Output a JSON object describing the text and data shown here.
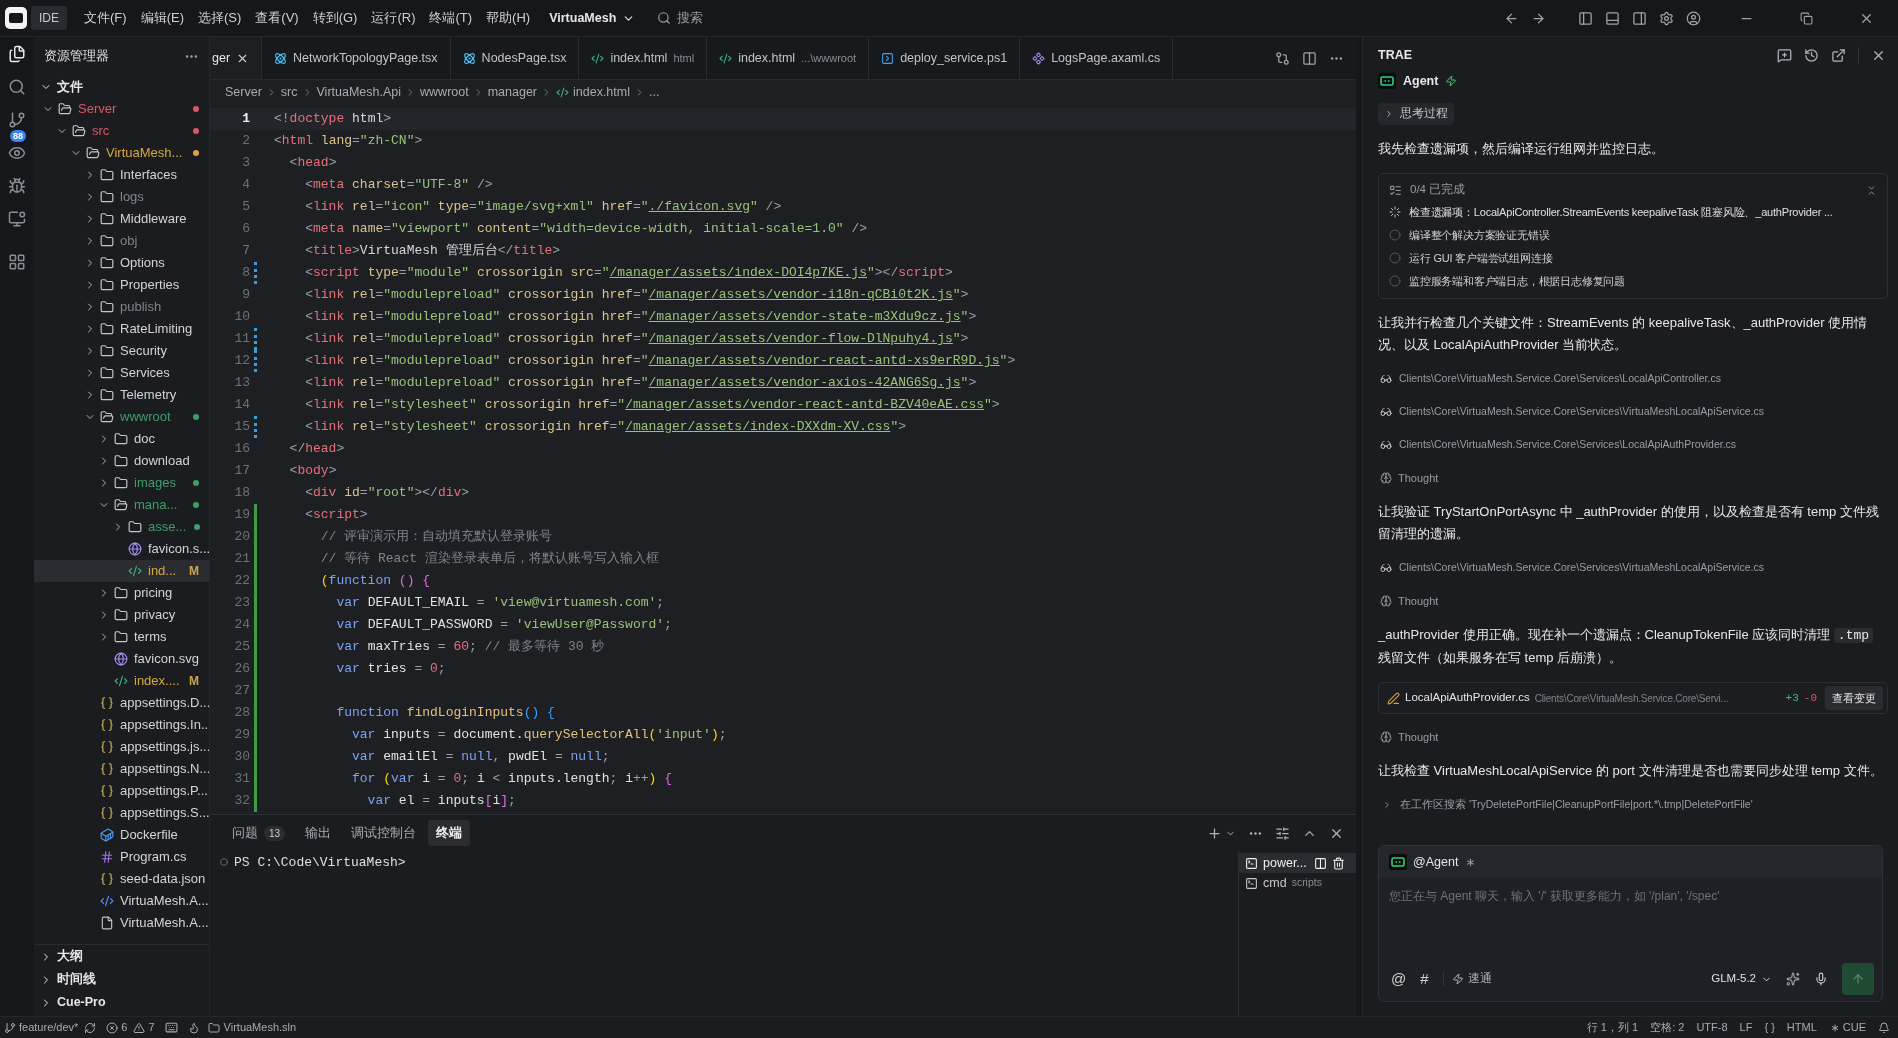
{
  "titlebar": {
    "badge": "IDE",
    "menus": [
      "文件(F)",
      "编辑(E)",
      "选择(S)",
      "查看(V)",
      "转到(G)",
      "运行(R)",
      "终端(T)",
      "帮助(H)"
    ],
    "project": "VirtuaMesh",
    "search_label": "搜索"
  },
  "activity_bar": [
    {
      "kind": "files",
      "selected": true
    },
    {
      "kind": "search",
      "selected": false
    },
    {
      "kind": "scm",
      "selected": false,
      "badge": "88"
    },
    {
      "kind": "preview",
      "selected": false
    },
    {
      "kind": "debug",
      "selected": false
    },
    {
      "kind": "remote",
      "selected": false
    },
    {
      "kind": "extensions",
      "selected": false
    }
  ],
  "explorer": {
    "title": "资源管理器",
    "section": {
      "label": "文件",
      "expanded": true
    },
    "tree": [
      {
        "name": "Server",
        "kind": "folder",
        "expanded": true,
        "selected": false,
        "color": "#e05561",
        "dot": true,
        "children": [
          {
            "name": "src",
            "kind": "folder",
            "expanded": true,
            "selected": false,
            "color": "#e05561",
            "dot": true,
            "children": [
              {
                "name": "VirtuaMesh...",
                "kind": "folder",
                "expanded": true,
                "selected": false,
                "color": "#d7a93a",
                "dot": true,
                "children": [
                  {
                    "name": "Interfaces",
                    "kind": "folder",
                    "expanded": false,
                    "selected": false
                  },
                  {
                    "name": "logs",
                    "kind": "folder",
                    "expanded": false,
                    "selected": false,
                    "color": "#80838b"
                  },
                  {
                    "name": "Middleware",
                    "kind": "folder",
                    "expanded": false,
                    "selected": false
                  },
                  {
                    "name": "obj",
                    "kind": "folder",
                    "expanded": false,
                    "selected": false,
                    "color": "#80838b"
                  },
                  {
                    "name": "Options",
                    "kind": "folder",
                    "expanded": false,
                    "selected": false
                  },
                  {
                    "name": "Properties",
                    "kind": "folder",
                    "expanded": false,
                    "selected": false
                  },
                  {
                    "name": "publish",
                    "kind": "folder",
                    "expanded": false,
                    "selected": false,
                    "color": "#80838b"
                  },
                  {
                    "name": "RateLimiting",
                    "kind": "folder",
                    "expanded": false,
                    "selected": false
                  },
                  {
                    "name": "Security",
                    "kind": "folder",
                    "expanded": false,
                    "selected": false
                  },
                  {
                    "name": "Services",
                    "kind": "folder",
                    "expanded": false,
                    "selected": false
                  },
                  {
                    "name": "Telemetry",
                    "kind": "folder",
                    "expanded": false,
                    "selected": false
                  },
                  {
                    "name": "wwwroot",
                    "kind": "folder",
                    "expanded": true,
                    "selected": false,
                    "color": "#3e9e6a",
                    "dot": true,
                    "children": [
                      {
                        "name": "doc",
                        "kind": "folder",
                        "expanded": false,
                        "selected": false
                      },
                      {
                        "name": "download",
                        "kind": "folder",
                        "expanded": false,
                        "selected": false
                      },
                      {
                        "name": "images",
                        "kind": "folder",
                        "expanded": false,
                        "selected": false,
                        "color": "#3e9e6a",
                        "dot": true
                      },
                      {
                        "name": "mana...",
                        "kind": "folder",
                        "expanded": true,
                        "selected": false,
                        "color": "#3e9e6a",
                        "dot": true,
                        "children": [
                          {
                            "name": "asse...",
                            "kind": "folder",
                            "expanded": false,
                            "selected": false,
                            "color": "#3e9e6a",
                            "dot": true
                          },
                          {
                            "name": "favicon.s...",
                            "kind": "svg",
                            "selected": false
                          },
                          {
                            "name": "ind...",
                            "kind": "html",
                            "selected": true,
                            "color": "#d7a93a",
                            "badge": "M"
                          }
                        ]
                      },
                      {
                        "name": "pricing",
                        "kind": "folder",
                        "expanded": false,
                        "selected": false
                      },
                      {
                        "name": "privacy",
                        "kind": "folder",
                        "expanded": false,
                        "selected": false
                      },
                      {
                        "name": "terms",
                        "kind": "folder",
                        "expanded": false,
                        "selected": false
                      },
                      {
                        "name": "favicon.svg",
                        "kind": "svg",
                        "selected": false
                      },
                      {
                        "name": "index....",
                        "kind": "html",
                        "selected": false,
                        "color": "#d7a93a",
                        "badge": "M"
                      }
                    ]
                  },
                  {
                    "name": "appsettings.D...",
                    "kind": "json",
                    "selected": false
                  },
                  {
                    "name": "appsettings.In...",
                    "kind": "json",
                    "selected": false
                  },
                  {
                    "name": "appsettings.js...",
                    "kind": "json",
                    "selected": false
                  },
                  {
                    "name": "appsettings.N...",
                    "kind": "json",
                    "selected": false
                  },
                  {
                    "name": "appsettings.P...",
                    "kind": "json",
                    "selected": false
                  },
                  {
                    "name": "appsettings.S...",
                    "kind": "json",
                    "selected": false
                  },
                  {
                    "name": "Dockerfile",
                    "kind": "docker",
                    "selected": false
                  },
                  {
                    "name": "Program.cs",
                    "kind": "csharp",
                    "selected": false
                  },
                  {
                    "name": "seed-data.json",
                    "kind": "json",
                    "selected": false
                  },
                  {
                    "name": "VirtuaMesh.A...",
                    "kind": "xml",
                    "selected": false
                  },
                  {
                    "name": "VirtuaMesh.A...",
                    "kind": "plain",
                    "selected": false
                  }
                ]
              }
            ]
          }
        ]
      }
    ],
    "footer_sections": [
      {
        "label": "大纲",
        "expanded": false
      },
      {
        "label": "时间线",
        "expanded": false
      },
      {
        "label": "Cue-Pro",
        "expanded": false
      }
    ]
  },
  "editor": {
    "tabs": [
      {
        "label": "ger",
        "kind": "cut",
        "selected": true
      },
      {
        "label": "NetworkTopologyPage.tsx",
        "kind": "react",
        "selected": false
      },
      {
        "label": "NodesPage.tsx",
        "kind": "react",
        "selected": false
      },
      {
        "label": "index.html",
        "detail": "html",
        "kind": "html",
        "selected": false
      },
      {
        "label": "index.html",
        "detail": "...\\wwwroot",
        "kind": "html",
        "selected": false
      },
      {
        "label": "deploy_service.ps1",
        "kind": "powershell",
        "selected": false
      },
      {
        "label": "LogsPage.axaml.cs",
        "kind": "axaml",
        "selected": false
      }
    ],
    "breadcrumb": [
      {
        "label": "Server",
        "kind": "folder"
      },
      {
        "label": "src",
        "kind": "folder"
      },
      {
        "label": "VirtuaMesh.Api",
        "kind": "folder"
      },
      {
        "label": "wwwroot",
        "kind": "folder"
      },
      {
        "label": "manager",
        "kind": "folder"
      },
      {
        "label": "index.html",
        "kind": "html"
      },
      {
        "label": "...",
        "kind": "symbol"
      }
    ],
    "lines": [
      {
        "n": "1",
        "current": true,
        "kind": "plain",
        "tokens": [
          {
            "kind": "p",
            "text": "<!"
          },
          {
            "kind": "tag",
            "text": "doctype "
          },
          {
            "kind": "txt",
            "text": "html"
          },
          {
            "kind": "p",
            "text": ">"
          }
        ]
      },
      {
        "n": "2",
        "current": false,
        "kind": "plain",
        "tokens": [
          {
            "kind": "p",
            "text": "<"
          },
          {
            "kind": "tag",
            "text": "html "
          },
          {
            "kind": "attr",
            "text": "lang"
          },
          {
            "kind": "p",
            "text": "="
          },
          {
            "kind": "str",
            "text": "\"zh-CN\""
          },
          {
            "kind": "p",
            "text": ">"
          }
        ]
      },
      {
        "n": "3",
        "current": false,
        "kind": "plain",
        "tokens": [
          {
            "kind": "p",
            "text": "  <"
          },
          {
            "kind": "tag",
            "text": "head"
          },
          {
            "kind": "p",
            "text": ">"
          }
        ]
      },
      {
        "n": "4",
        "current": false,
        "kind": "plain",
        "tokens": [
          {
            "kind": "p",
            "text": "    <"
          },
          {
            "kind": "tag",
            "text": "meta "
          },
          {
            "kind": "attr",
            "text": "charset"
          },
          {
            "kind": "p",
            "text": "="
          },
          {
            "kind": "str",
            "text": "\"UTF-8\" "
          },
          {
            "kind": "p",
            "text": "/>"
          }
        ]
      },
      {
        "n": "5",
        "current": false,
        "kind": "plain",
        "tokens": [
          {
            "kind": "p",
            "text": "    <"
          },
          {
            "kind": "tag",
            "text": "link "
          },
          {
            "kind": "attr",
            "text": "rel"
          },
          {
            "kind": "p",
            "text": "="
          },
          {
            "kind": "str",
            "text": "\"icon\" "
          },
          {
            "kind": "attr",
            "text": "type"
          },
          {
            "kind": "p",
            "text": "="
          },
          {
            "kind": "str",
            "text": "\"image/svg+xml\" "
          },
          {
            "kind": "attr",
            "text": "href"
          },
          {
            "kind": "p",
            "text": "="
          },
          {
            "kind": "str",
            "text": "\""
          },
          {
            "kind": "link",
            "text": "./favicon.svg"
          },
          {
            "kind": "str",
            "text": "\" "
          },
          {
            "kind": "p",
            "text": "/>"
          }
        ]
      },
      {
        "n": "6",
        "current": false,
        "kind": "plain",
        "tokens": [
          {
            "kind": "p",
            "text": "    <"
          },
          {
            "kind": "tag",
            "text": "meta "
          },
          {
            "kind": "attr",
            "text": "name"
          },
          {
            "kind": "p",
            "text": "="
          },
          {
            "kind": "str",
            "text": "\"viewport\" "
          },
          {
            "kind": "attr",
            "text": "content"
          },
          {
            "kind": "p",
            "text": "="
          },
          {
            "kind": "str",
            "text": "\"width=device-width, initial-scale=1.0\" "
          },
          {
            "kind": "p",
            "text": "/>"
          }
        ]
      },
      {
        "n": "7",
        "current": false,
        "kind": "plain",
        "tokens": [
          {
            "kind": "p",
            "text": "    <"
          },
          {
            "kind": "tag",
            "text": "title"
          },
          {
            "kind": "p",
            "text": ">"
          },
          {
            "kind": "txt",
            "text": "VirtuaMesh 管理后台"
          },
          {
            "kind": "p",
            "text": "</"
          },
          {
            "kind": "tag",
            "text": "title"
          },
          {
            "kind": "p",
            "text": ">"
          }
        ]
      },
      {
        "n": "8",
        "current": false,
        "kind": "modified",
        "tokens": [
          {
            "kind": "p",
            "text": "    <"
          },
          {
            "kind": "tag",
            "text": "script "
          },
          {
            "kind": "attr",
            "text": "type"
          },
          {
            "kind": "p",
            "text": "="
          },
          {
            "kind": "str",
            "text": "\"module\" "
          },
          {
            "kind": "attr",
            "text": "crossorigin src"
          },
          {
            "kind": "p",
            "text": "="
          },
          {
            "kind": "str",
            "text": "\""
          },
          {
            "kind": "link",
            "text": "/manager/assets/index-DOI4p7KE.js"
          },
          {
            "kind": "str",
            "text": "\""
          },
          {
            "kind": "p",
            "text": "></"
          },
          {
            "kind": "tag",
            "text": "script"
          },
          {
            "kind": "p",
            "text": ">"
          }
        ]
      },
      {
        "n": "9",
        "current": false,
        "kind": "plain",
        "tokens": [
          {
            "kind": "p",
            "text": "    <"
          },
          {
            "kind": "tag",
            "text": "link "
          },
          {
            "kind": "attr",
            "text": "rel"
          },
          {
            "kind": "p",
            "text": "="
          },
          {
            "kind": "str",
            "text": "\"modulepreload\" "
          },
          {
            "kind": "attr",
            "text": "crossorigin href"
          },
          {
            "kind": "p",
            "text": "="
          },
          {
            "kind": "str",
            "text": "\""
          },
          {
            "kind": "link",
            "text": "/manager/assets/vendor-i18n-qCBi0t2K.js"
          },
          {
            "kind": "str",
            "text": "\""
          },
          {
            "kind": "p",
            "text": ">"
          }
        ]
      },
      {
        "n": "10",
        "current": false,
        "kind": "plain",
        "tokens": [
          {
            "kind": "p",
            "text": "    <"
          },
          {
            "kind": "tag",
            "text": "link "
          },
          {
            "kind": "attr",
            "text": "rel"
          },
          {
            "kind": "p",
            "text": "="
          },
          {
            "kind": "str",
            "text": "\"modulepreload\" "
          },
          {
            "kind": "attr",
            "text": "crossorigin href"
          },
          {
            "kind": "p",
            "text": "="
          },
          {
            "kind": "str",
            "text": "\""
          },
          {
            "kind": "link",
            "text": "/manager/assets/vendor-state-m3Xdu9cz.js"
          },
          {
            "kind": "str",
            "text": "\""
          },
          {
            "kind": "p",
            "text": ">"
          }
        ]
      },
      {
        "n": "11",
        "current": false,
        "kind": "modified",
        "tokens": [
          {
            "kind": "p",
            "text": "    <"
          },
          {
            "kind": "tag",
            "text": "link "
          },
          {
            "kind": "attr",
            "text": "rel"
          },
          {
            "kind": "p",
            "text": "="
          },
          {
            "kind": "str",
            "text": "\"modulepreload\" "
          },
          {
            "kind": "attr",
            "text": "crossorigin href"
          },
          {
            "kind": "p",
            "text": "="
          },
          {
            "kind": "str",
            "text": "\""
          },
          {
            "kind": "link",
            "text": "/manager/assets/vendor-flow-DlNpuhy4.js"
          },
          {
            "kind": "str",
            "text": "\""
          },
          {
            "kind": "p",
            "text": ">"
          }
        ]
      },
      {
        "n": "12",
        "current": false,
        "kind": "modified",
        "tokens": [
          {
            "kind": "p",
            "text": "    <"
          },
          {
            "kind": "tag",
            "text": "link "
          },
          {
            "kind": "attr",
            "text": "rel"
          },
          {
            "kind": "p",
            "text": "="
          },
          {
            "kind": "str",
            "text": "\"modulepreload\" "
          },
          {
            "kind": "attr",
            "text": "crossorigin href"
          },
          {
            "kind": "p",
            "text": "="
          },
          {
            "kind": "str",
            "text": "\""
          },
          {
            "kind": "link",
            "text": "/manager/assets/vendor-react-antd-xs9erR9D.js"
          },
          {
            "kind": "str",
            "text": "\""
          },
          {
            "kind": "p",
            "text": ">"
          }
        ]
      },
      {
        "n": "13",
        "current": false,
        "kind": "plain",
        "tokens": [
          {
            "kind": "p",
            "text": "    <"
          },
          {
            "kind": "tag",
            "text": "link "
          },
          {
            "kind": "attr",
            "text": "rel"
          },
          {
            "kind": "p",
            "text": "="
          },
          {
            "kind": "str",
            "text": "\"modulepreload\" "
          },
          {
            "kind": "attr",
            "text": "crossorigin href"
          },
          {
            "kind": "p",
            "text": "="
          },
          {
            "kind": "str",
            "text": "\""
          },
          {
            "kind": "link",
            "text": "/manager/assets/vendor-axios-42ANG6Sg.js"
          },
          {
            "kind": "str",
            "text": "\""
          },
          {
            "kind": "p",
            "text": ">"
          }
        ]
      },
      {
        "n": "14",
        "current": false,
        "kind": "plain",
        "tokens": [
          {
            "kind": "p",
            "text": "    <"
          },
          {
            "kind": "tag",
            "text": "link "
          },
          {
            "kind": "attr",
            "text": "rel"
          },
          {
            "kind": "p",
            "text": "="
          },
          {
            "kind": "str",
            "text": "\"stylesheet\" "
          },
          {
            "kind": "attr",
            "text": "crossorigin href"
          },
          {
            "kind": "p",
            "text": "="
          },
          {
            "kind": "str",
            "text": "\""
          },
          {
            "kind": "link",
            "text": "/manager/assets/vendor-react-antd-BZV40eAE.css"
          },
          {
            "kind": "str",
            "text": "\""
          },
          {
            "kind": "p",
            "text": ">"
          }
        ]
      },
      {
        "n": "15",
        "current": false,
        "kind": "modified",
        "tokens": [
          {
            "kind": "p",
            "text": "    <"
          },
          {
            "kind": "tag",
            "text": "link "
          },
          {
            "kind": "attr",
            "text": "rel"
          },
          {
            "kind": "p",
            "text": "="
          },
          {
            "kind": "str",
            "text": "\"stylesheet\" "
          },
          {
            "kind": "attr",
            "text": "crossorigin href"
          },
          {
            "kind": "p",
            "text": "="
          },
          {
            "kind": "str",
            "text": "\""
          },
          {
            "kind": "link",
            "text": "/manager/assets/index-DXXdm-XV.css"
          },
          {
            "kind": "str",
            "text": "\""
          },
          {
            "kind": "p",
            "text": ">"
          }
        ]
      },
      {
        "n": "16",
        "current": false,
        "kind": "plain",
        "tokens": [
          {
            "kind": "p",
            "text": "  </"
          },
          {
            "kind": "tag",
            "text": "head"
          },
          {
            "kind": "p",
            "text": ">"
          }
        ]
      },
      {
        "n": "17",
        "current": false,
        "kind": "plain",
        "tokens": [
          {
            "kind": "p",
            "text": "  <"
          },
          {
            "kind": "tag",
            "text": "body"
          },
          {
            "kind": "p",
            "text": ">"
          }
        ]
      },
      {
        "n": "18",
        "current": false,
        "kind": "plain",
        "tokens": [
          {
            "kind": "p",
            "text": "    <"
          },
          {
            "kind": "tag",
            "text": "div "
          },
          {
            "kind": "attr",
            "text": "id"
          },
          {
            "kind": "p",
            "text": "="
          },
          {
            "kind": "str",
            "text": "\"root\""
          },
          {
            "kind": "p",
            "text": "></"
          },
          {
            "kind": "tag",
            "text": "div"
          },
          {
            "kind": "p",
            "text": ">"
          }
        ]
      },
      {
        "n": "19",
        "current": false,
        "kind": "added",
        "tokens": [
          {
            "kind": "p",
            "text": "    <"
          },
          {
            "kind": "tag",
            "text": "script"
          },
          {
            "kind": "p",
            "text": ">"
          }
        ]
      },
      {
        "n": "20",
        "current": false,
        "kind": "added",
        "tokens": [
          {
            "kind": "cm",
            "text": "      // 评审演示用：自动填充默认登录账号"
          }
        ]
      },
      {
        "n": "21",
        "current": false,
        "kind": "added",
        "tokens": [
          {
            "kind": "cm",
            "text": "      // 等待 React 渲染登录表单后，将默认账号写入输入框"
          }
        ]
      },
      {
        "n": "22",
        "current": false,
        "kind": "added",
        "tokens": [
          {
            "kind": "b1",
            "text": "      ("
          },
          {
            "kind": "kw",
            "text": "function "
          },
          {
            "kind": "b2",
            "text": "() {"
          }
        ]
      },
      {
        "n": "23",
        "current": false,
        "kind": "added",
        "tokens": [
          {
            "kind": "kw",
            "text": "        var "
          },
          {
            "kind": "id",
            "text": "DEFAULT_EMAIL "
          },
          {
            "kind": "p",
            "text": "= "
          },
          {
            "kind": "str",
            "text": "'view@virtuamesh.com'"
          },
          {
            "kind": "p",
            "text": ";"
          }
        ]
      },
      {
        "n": "24",
        "current": false,
        "kind": "added",
        "tokens": [
          {
            "kind": "kw",
            "text": "        var "
          },
          {
            "kind": "id",
            "text": "DEFAULT_PASSWORD "
          },
          {
            "kind": "p",
            "text": "= "
          },
          {
            "kind": "str",
            "text": "'viewUser@Password'"
          },
          {
            "kind": "p",
            "text": ";"
          }
        ]
      },
      {
        "n": "25",
        "current": false,
        "kind": "added",
        "tokens": [
          {
            "kind": "kw",
            "text": "        var "
          },
          {
            "kind": "id",
            "text": "maxTries "
          },
          {
            "kind": "p",
            "text": "= "
          },
          {
            "kind": "num",
            "text": "60"
          },
          {
            "kind": "p",
            "text": "; "
          },
          {
            "kind": "cm",
            "text": "// 最多等待 30 秒"
          }
        ]
      },
      {
        "n": "26",
        "current": false,
        "kind": "added",
        "tokens": [
          {
            "kind": "kw",
            "text": "        var "
          },
          {
            "kind": "id",
            "text": "tries "
          },
          {
            "kind": "p",
            "text": "= "
          },
          {
            "kind": "num",
            "text": "0"
          },
          {
            "kind": "p",
            "text": ";"
          }
        ]
      },
      {
        "n": "27",
        "current": false,
        "kind": "added"
      },
      {
        "n": "28",
        "current": false,
        "kind": "added",
        "tokens": [
          {
            "kind": "kw",
            "text": "        function "
          },
          {
            "kind": "fn",
            "text": "findLoginInputs"
          },
          {
            "kind": "b3",
            "text": "() {"
          }
        ]
      },
      {
        "n": "29",
        "current": false,
        "kind": "added",
        "tokens": [
          {
            "kind": "kw",
            "text": "          var "
          },
          {
            "kind": "id",
            "text": "inputs "
          },
          {
            "kind": "p",
            "text": "= "
          },
          {
            "kind": "id",
            "text": "document."
          },
          {
            "kind": "fn",
            "text": "querySelectorAll"
          },
          {
            "kind": "b1",
            "text": "("
          },
          {
            "kind": "str",
            "text": "'input'"
          },
          {
            "kind": "b1",
            "text": ")"
          },
          {
            "kind": "p",
            "text": ";"
          }
        ]
      },
      {
        "n": "30",
        "current": false,
        "kind": "added",
        "tokens": [
          {
            "kind": "kw",
            "text": "          var "
          },
          {
            "kind": "id",
            "text": "emailEl "
          },
          {
            "kind": "p",
            "text": "= "
          },
          {
            "kind": "kw",
            "text": "null"
          },
          {
            "kind": "p",
            "text": ", "
          },
          {
            "kind": "id",
            "text": "pwdEl "
          },
          {
            "kind": "p",
            "text": "= "
          },
          {
            "kind": "kw",
            "text": "null"
          },
          {
            "kind": "p",
            "text": ";"
          }
        ]
      },
      {
        "n": "31",
        "current": false,
        "kind": "added",
        "tokens": [
          {
            "kind": "kw",
            "text": "          for "
          },
          {
            "kind": "b1",
            "text": "("
          },
          {
            "kind": "kw",
            "text": "var "
          },
          {
            "kind": "id",
            "text": "i "
          },
          {
            "kind": "p",
            "text": "= "
          },
          {
            "kind": "num",
            "text": "0"
          },
          {
            "kind": "p",
            "text": "; "
          },
          {
            "kind": "id",
            "text": "i "
          },
          {
            "kind": "p",
            "text": "< "
          },
          {
            "kind": "id",
            "text": "inputs.length"
          },
          {
            "kind": "p",
            "text": "; "
          },
          {
            "kind": "id",
            "text": "i"
          },
          {
            "kind": "p",
            "text": "++"
          },
          {
            "kind": "b1",
            "text": ") "
          },
          {
            "kind": "b2",
            "text": "{"
          }
        ]
      },
      {
        "n": "32",
        "current": false,
        "kind": "added",
        "tokens": [
          {
            "kind": "kw",
            "text": "            var "
          },
          {
            "kind": "id",
            "text": "el "
          },
          {
            "kind": "p",
            "text": "= "
          },
          {
            "kind": "id",
            "text": "inputs"
          },
          {
            "kind": "b2",
            "text": "["
          },
          {
            "kind": "id",
            "text": "i"
          },
          {
            "kind": "b2",
            "text": "]"
          },
          {
            "kind": "p",
            "text": ";"
          }
        ]
      }
    ]
  },
  "panel": {
    "tabs": [
      {
        "label": "问题",
        "count": "13",
        "selected": false
      },
      {
        "label": "输出",
        "selected": false
      },
      {
        "label": "调试控制台",
        "selected": false
      },
      {
        "label": "终端",
        "selected": true
      }
    ],
    "prompt": "PS C:\\Code\\VirtuaMesh>",
    "terminals": [
      {
        "name": "power...",
        "selected": true
      },
      {
        "name": "cmd",
        "detail": "scripts",
        "selected": false
      }
    ]
  },
  "agent": {
    "title": "TRAE",
    "mode": "Agent",
    "items": [
      {
        "kind": "collapsible",
        "text": "思考过程"
      },
      {
        "kind": "text",
        "parts": [
          {
            "kind": "text",
            "text": "我先检查遗漏项，然后编译运行组网并监控日志。"
          }
        ]
      },
      {
        "kind": "todo",
        "title": "0/4 已完成",
        "tasks": [
          {
            "text": "检查遗漏项：LocalApiController.StreamEvents keepaliveTask 阻塞风险、_authProvider ...",
            "kind": "in_progress"
          },
          {
            "text": "编译整个解决方案验证无错误",
            "kind": "pending"
          },
          {
            "text": "运行 GUI 客户端尝试组网连接",
            "kind": "pending"
          },
          {
            "text": "监控服务端和客户端日志，根据日志修复问题",
            "kind": "pending"
          }
        ]
      },
      {
        "kind": "text",
        "parts": [
          {
            "kind": "text",
            "text": "让我并行检查几个关键文件：StreamEvents 的 keepaliveTask、_authProvider 使用情况、以及 LocalApiAuthProvider 当前状态。"
          }
        ]
      },
      {
        "kind": "read",
        "text": "Clients\\Core\\VirtuaMesh.Service.Core\\Services\\LocalApiController.cs"
      },
      {
        "kind": "read",
        "text": "Clients\\Core\\VirtuaMesh.Service.Core\\Services\\VirtuaMeshLocalApiService.cs"
      },
      {
        "kind": "read",
        "text": "Clients\\Core\\VirtuaMesh.Service.Core\\Services\\LocalApiAuthProvider.cs"
      },
      {
        "kind": "thought",
        "text": "Thought"
      },
      {
        "kind": "text",
        "parts": [
          {
            "kind": "text",
            "text": "让我验证 TryStartOnPortAsync 中 _authProvider 的使用，以及检查是否有 temp 文件残留清理的遗漏。"
          }
        ]
      },
      {
        "kind": "read",
        "text": "Clients\\Core\\VirtuaMesh.Service.Core\\Services\\VirtuaMeshLocalApiService.cs"
      },
      {
        "kind": "thought",
        "text": "Thought"
      },
      {
        "kind": "text",
        "parts": [
          {
            "kind": "text",
            "text": "_authProvider 使用正确。现在补一个遗漏点：CleanupTokenFile 应该同时清理 "
          },
          {
            "kind": "code",
            "text": ".tmp"
          },
          {
            "kind": "text",
            "text": " 残留文件（如果服务在写 temp 后崩溃）。"
          }
        ]
      },
      {
        "kind": "edit",
        "file": "LocalApiAuthProvider.cs",
        "path": "Clients\\Core\\VirtuaMesh.Service.Core\\Servi...",
        "added": "+3",
        "removed": "-0",
        "button": "查看变更"
      },
      {
        "kind": "thought",
        "text": "Thought"
      },
      {
        "kind": "text",
        "parts": [
          {
            "kind": "text",
            "text": "让我检查 VirtuaMeshLocalApiService 的 port 文件清理是否也需要同步处理 temp 文件。"
          }
        ]
      },
      {
        "kind": "search",
        "text": "在工作区搜索 'TryDeletePortFile|CleanupPortFile|port.*\\.tmp|DeletePortFile'"
      }
    ],
    "input": {
      "chip": "@Agent",
      "placeholder": "您正在与 Agent 聊天，输入 '/' 获取更多能力，如 '/plan', '/spec'",
      "tools": [
        "@",
        "#"
      ],
      "speed": "速通",
      "model": "GLM-5.2"
    }
  },
  "status_bar": {
    "branch": "feature/dev*",
    "errors": "6",
    "warnings": "7",
    "workspace": "VirtuaMesh.sln",
    "right": [
      {
        "kind": "text",
        "text": "行 1，列 1"
      },
      {
        "kind": "text",
        "text": "空格: 2"
      },
      {
        "kind": "text",
        "text": "UTF-8"
      },
      {
        "kind": "text",
        "text": "LF"
      },
      {
        "kind": "text",
        "text": "{ }"
      },
      {
        "kind": "text",
        "text": "HTML"
      },
      {
        "kind": "cue",
        "text": "CUE"
      },
      {
        "kind": "bell"
      }
    ]
  }
}
